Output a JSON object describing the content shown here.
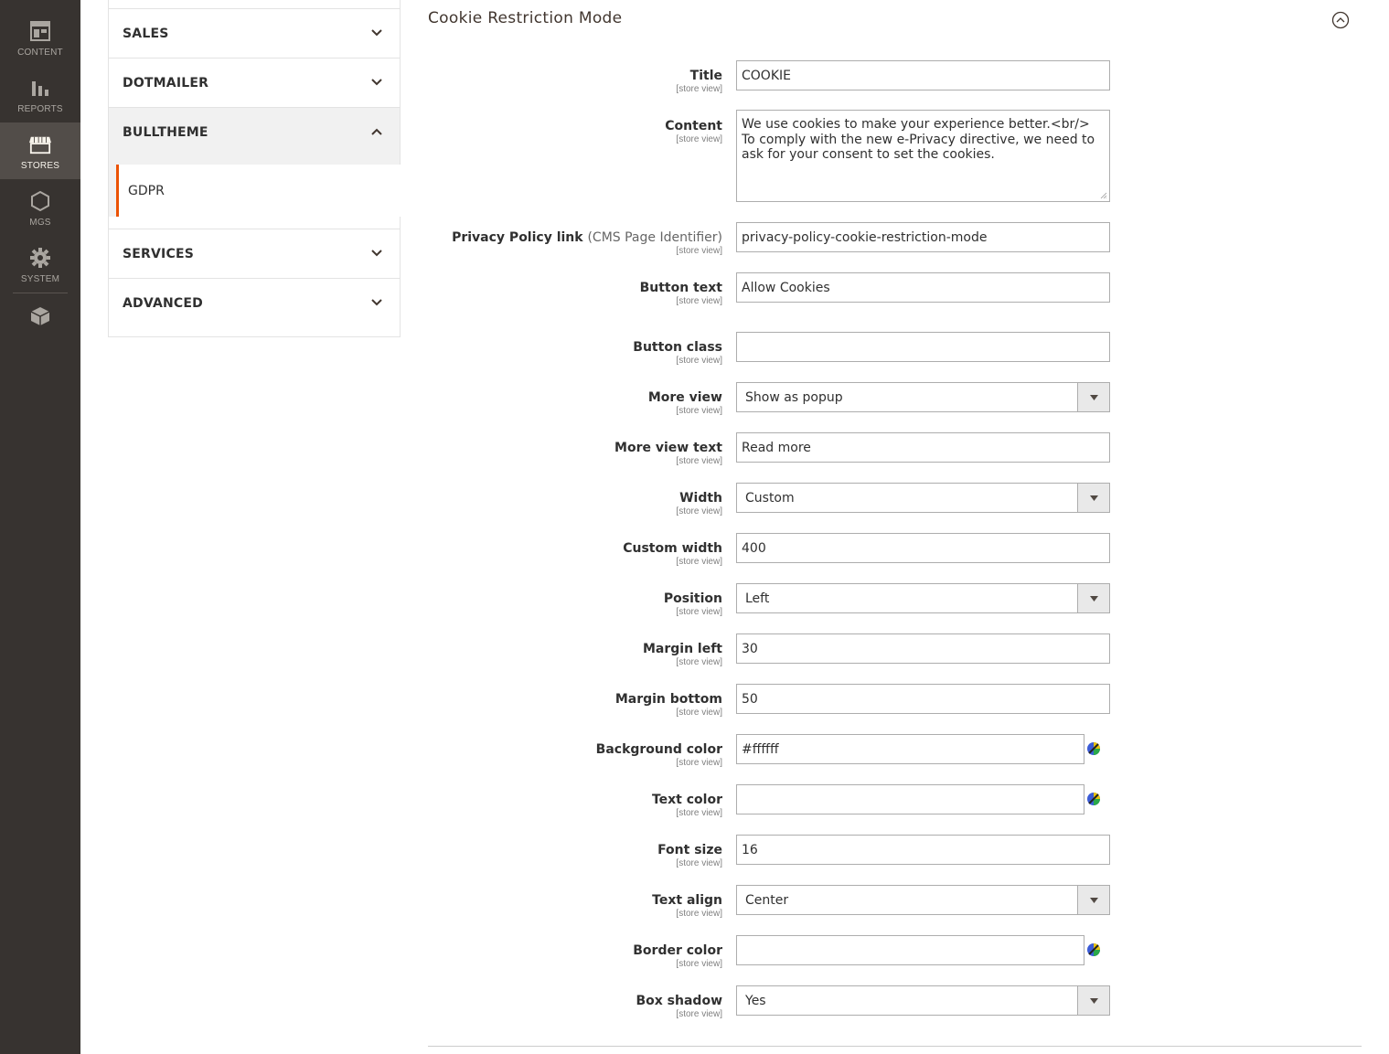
{
  "menu": {
    "items": [
      {
        "label": "CONTENT",
        "icon": "content-icon"
      },
      {
        "label": "REPORTS",
        "icon": "reports-icon"
      },
      {
        "label": "STORES",
        "icon": "stores-icon"
      },
      {
        "label": "MGS",
        "icon": "hexagon-icon"
      },
      {
        "label": "SYSTEM",
        "icon": "gear-icon"
      }
    ],
    "extra_icon": "cube-icon"
  },
  "tabs": {
    "sales": "SALES",
    "dotmailer": "DOTMAILER",
    "bulltheme": "BULLTHEME",
    "gdpr": "GDPR",
    "services": "SERVICES",
    "advanced": "ADVANCED"
  },
  "section": {
    "title": "Cookie Restriction Mode",
    "scope": "[store view]",
    "fields": {
      "title": {
        "label": "Title",
        "value": "COOKIE"
      },
      "content": {
        "label": "Content",
        "value": "We use cookies to make your experience better.<br/> To comply with the new e-Privacy directive, we need to ask for your consent to set the cookies."
      },
      "privacy": {
        "label": "Privacy Policy link",
        "note": "(CMS Page Identifier)",
        "value": "privacy-policy-cookie-restriction-mode"
      },
      "button_text": {
        "label": "Button text",
        "value": "Allow Cookies"
      },
      "button_class": {
        "label": "Button class",
        "value": ""
      },
      "more_view": {
        "label": "More view",
        "value": "Show as popup"
      },
      "more_view_text": {
        "label": "More view text",
        "value": "Read more"
      },
      "width": {
        "label": "Width",
        "value": "Custom"
      },
      "custom_width": {
        "label": "Custom width",
        "value": "400"
      },
      "position": {
        "label": "Position",
        "value": "Left"
      },
      "margin_left": {
        "label": "Margin left",
        "value": "30"
      },
      "margin_bottom": {
        "label": "Margin bottom",
        "value": "50"
      },
      "background_color": {
        "label": "Background color",
        "value": "#ffffff"
      },
      "text_color": {
        "label": "Text color",
        "value": ""
      },
      "font_size": {
        "label": "Font size",
        "value": "16"
      },
      "text_align": {
        "label": "Text align",
        "value": "Center"
      },
      "border_color": {
        "label": "Border color",
        "value": ""
      },
      "box_shadow": {
        "label": "Box shadow",
        "value": "Yes"
      }
    }
  },
  "colors": {
    "menu_bg": "#373330",
    "menu_active": "#524d49",
    "accent": "#eb5202"
  }
}
